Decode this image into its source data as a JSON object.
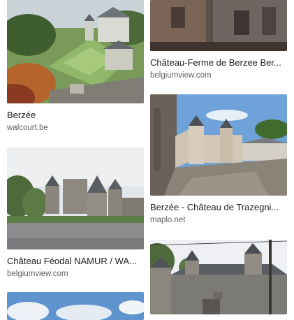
{
  "results": [
    {
      "title": "Berzée",
      "source": "walcourt.be"
    },
    {
      "title": "Château-Ferme de Berzee Ber...",
      "source": "belgiumview.com"
    },
    {
      "title": "Berzée - Château de Trazegni...",
      "source": "maplo.net"
    },
    {
      "title": "Château Féodal NAMUR / WA...",
      "source": "belgiumview.com"
    }
  ]
}
